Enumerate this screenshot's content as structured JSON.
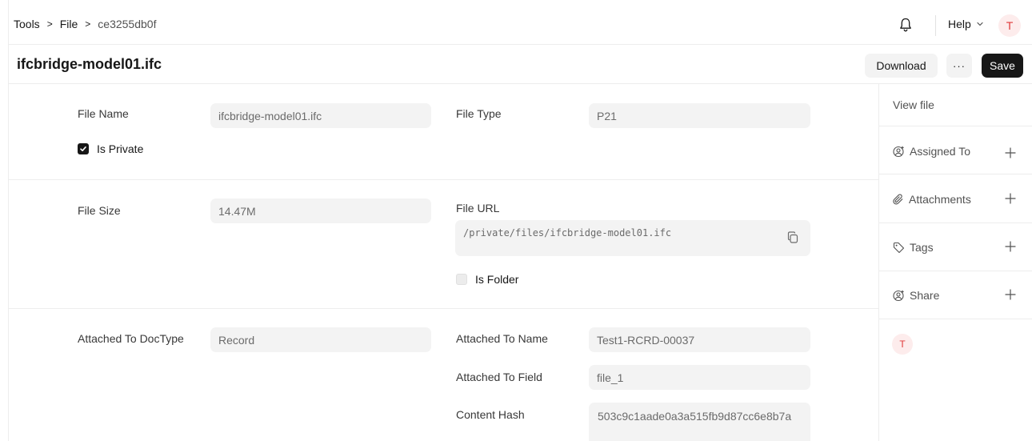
{
  "breadcrumb": {
    "items": [
      "Tools",
      "File",
      "ce3255db0f"
    ],
    "separator": ">"
  },
  "topbar": {
    "help_label": "Help",
    "avatar_initial": "T"
  },
  "header": {
    "title": "ifcbridge-model01.ifc",
    "download_label": "Download",
    "more_label": "···",
    "save_label": "Save"
  },
  "form": {
    "file_name": {
      "label": "File Name",
      "value": "ifcbridge-model01.ifc"
    },
    "file_type": {
      "label": "File Type",
      "value": "P21"
    },
    "is_private": {
      "label": "Is Private",
      "checked": true
    },
    "file_size": {
      "label": "File Size",
      "value": "14.47M"
    },
    "file_url": {
      "label": "File URL",
      "value": "/private/files/ifcbridge-model01.ifc"
    },
    "is_folder": {
      "label": "Is Folder",
      "checked": false
    },
    "attached_to_doctype": {
      "label": "Attached To DocType",
      "value": "Record"
    },
    "attached_to_name": {
      "label": "Attached To Name",
      "value": "Test1-RCRD-00037"
    },
    "attached_to_field": {
      "label": "Attached To Field",
      "value": "file_1"
    },
    "content_hash": {
      "label": "Content Hash",
      "value": "503c9c1aade0a3a515fb9d87cc6e8b7a"
    }
  },
  "sidebar": {
    "view_file": "View file",
    "assigned_to": "Assigned To",
    "attachments": "Attachments",
    "tags": "Tags",
    "share": "Share",
    "avatar_initial": "T"
  },
  "colors": {
    "accent_dark": "#171717",
    "avatar_bg": "#fdecec",
    "avatar_text": "#e03a3a",
    "field_bg": "#f3f3f3"
  }
}
